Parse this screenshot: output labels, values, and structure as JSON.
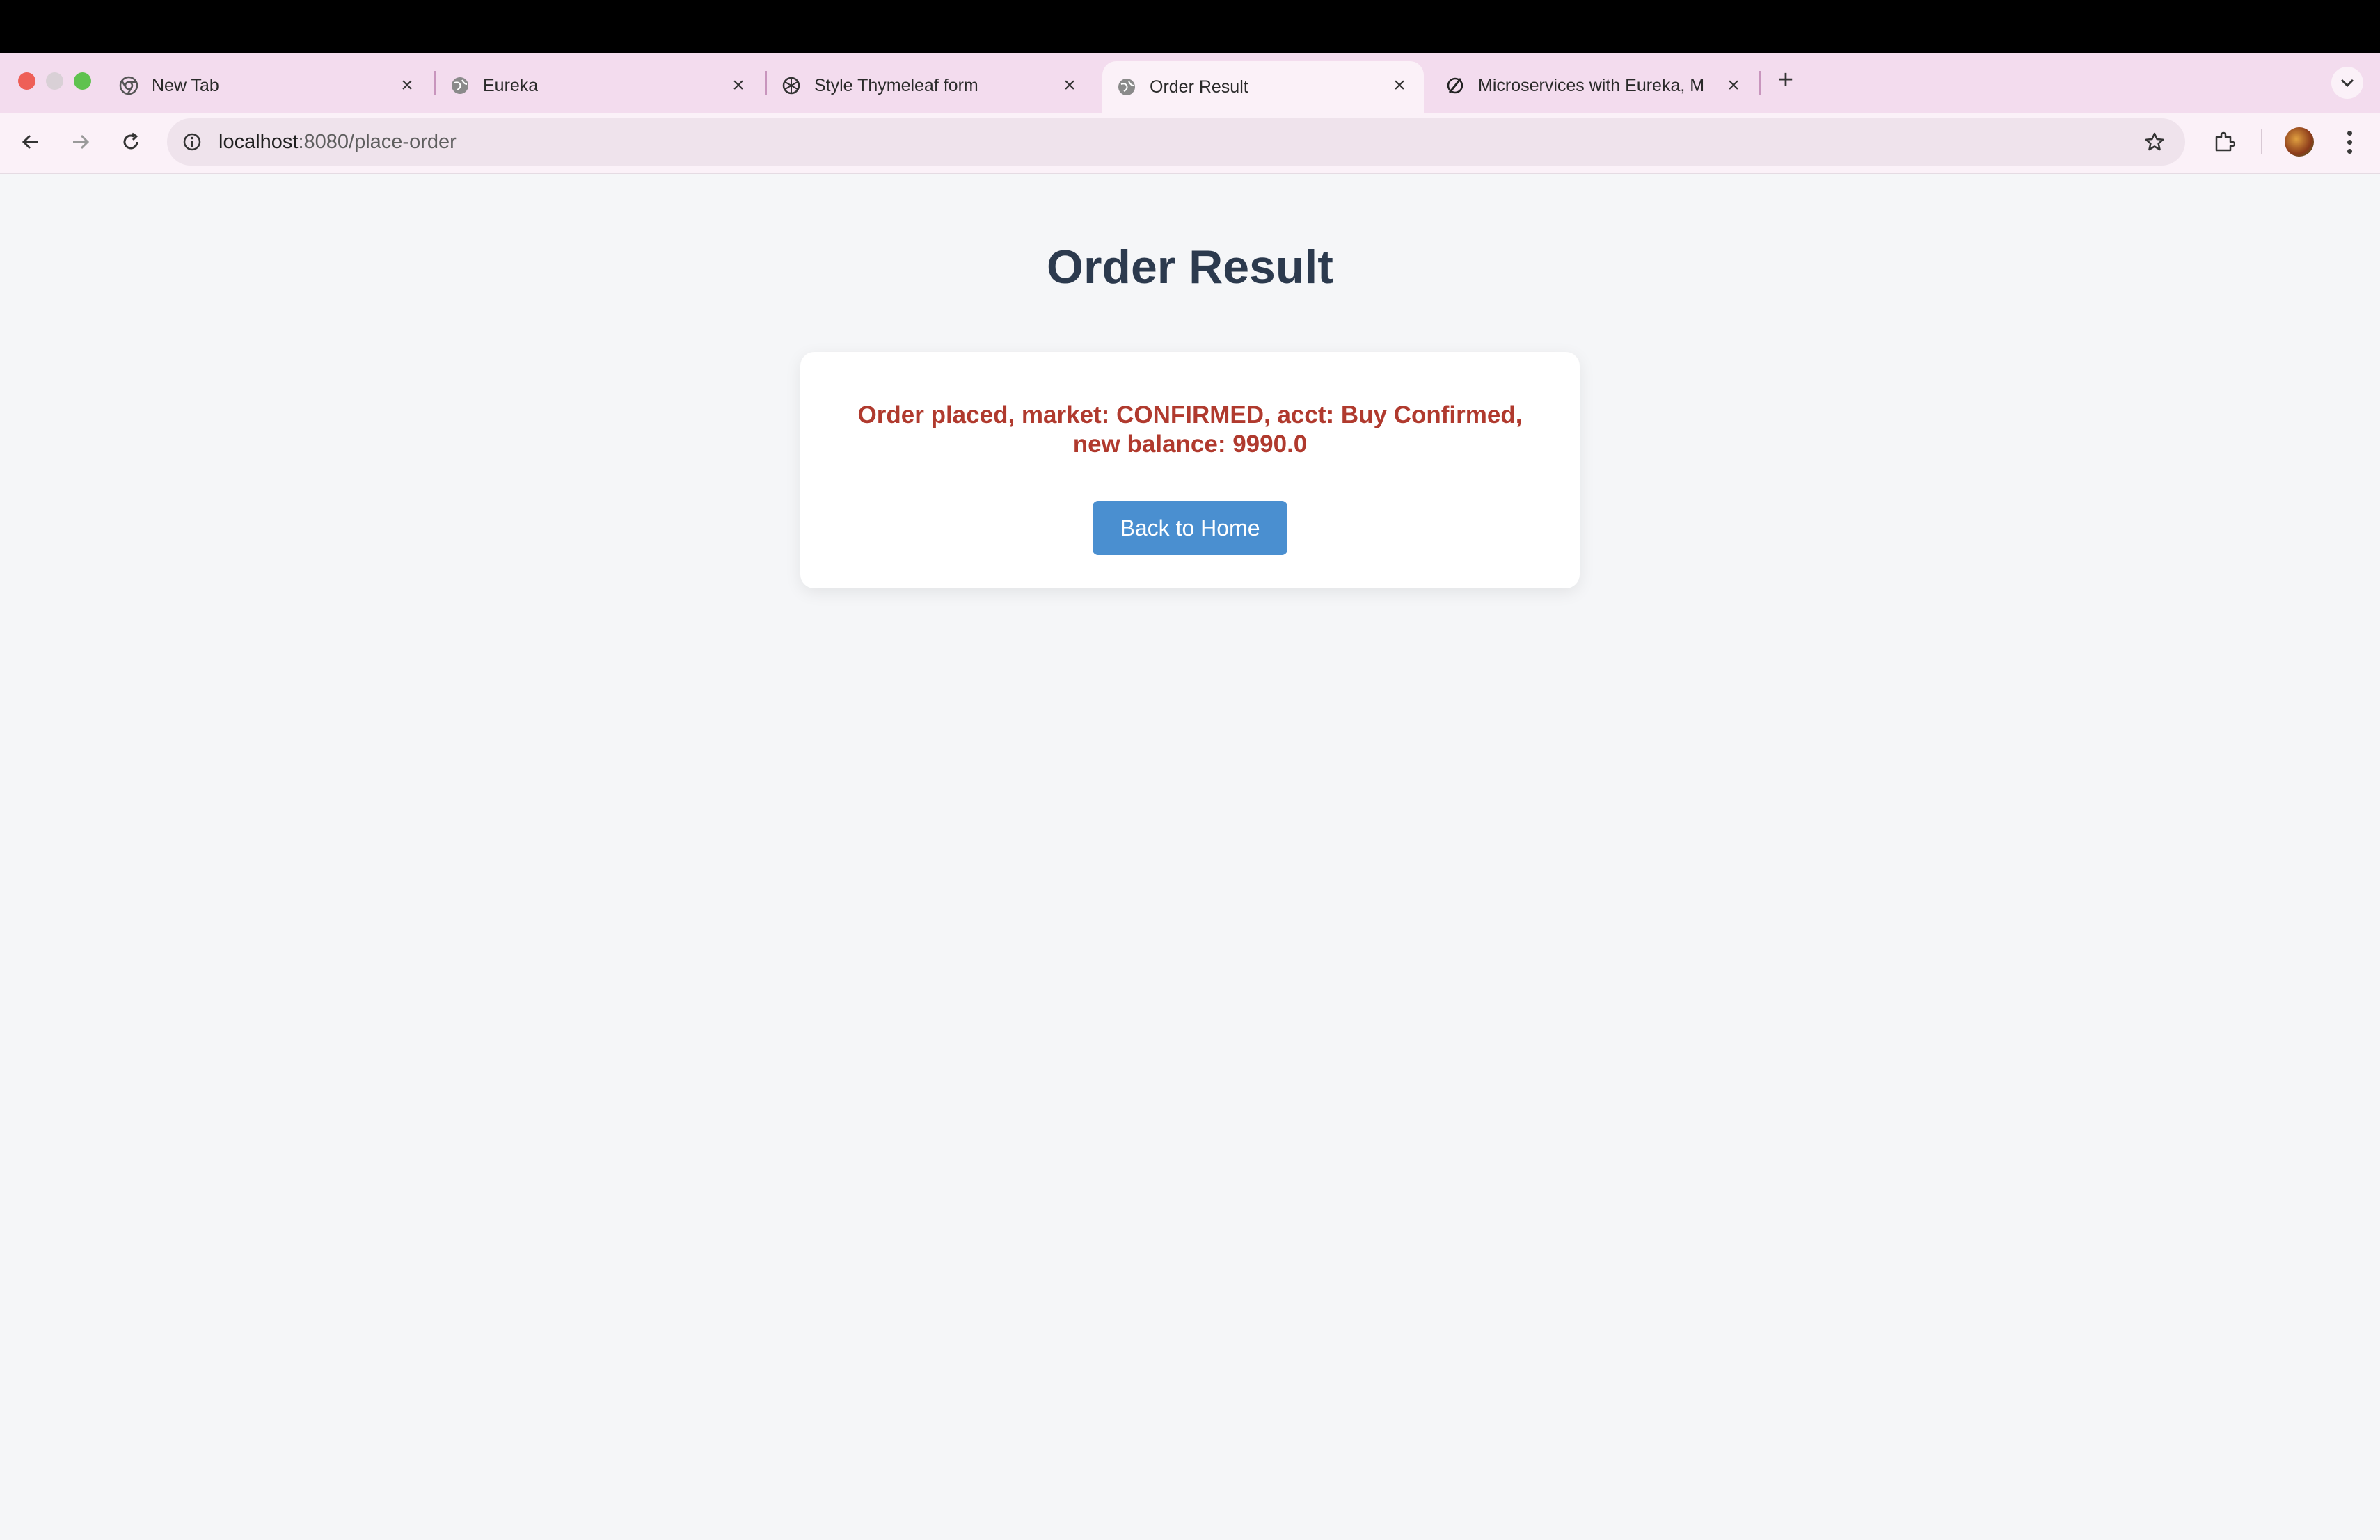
{
  "browser": {
    "tabs": [
      {
        "label": "New Tab",
        "icon": "chrome-icon",
        "active": false
      },
      {
        "label": "Eureka",
        "icon": "globe-icon",
        "active": false
      },
      {
        "label": "Style Thymeleaf form",
        "icon": "openai-icon",
        "active": false
      },
      {
        "label": "Order Result",
        "icon": "globe-icon",
        "active": true
      },
      {
        "label": "Microservices with Eureka, M",
        "icon": "link-icon",
        "active": false
      }
    ],
    "url_host": "localhost",
    "url_rest": ":8080/place-order"
  },
  "page": {
    "title": "Order Result",
    "message": "Order placed, market: CONFIRMED, acct: Buy Confirmed, new balance: 9990.0",
    "button_label": "Back to Home"
  },
  "colors": {
    "heading": "#2c3a4e",
    "message": "#b03a2e",
    "button": "#4a8fd0",
    "background": "#f5f6f8"
  }
}
